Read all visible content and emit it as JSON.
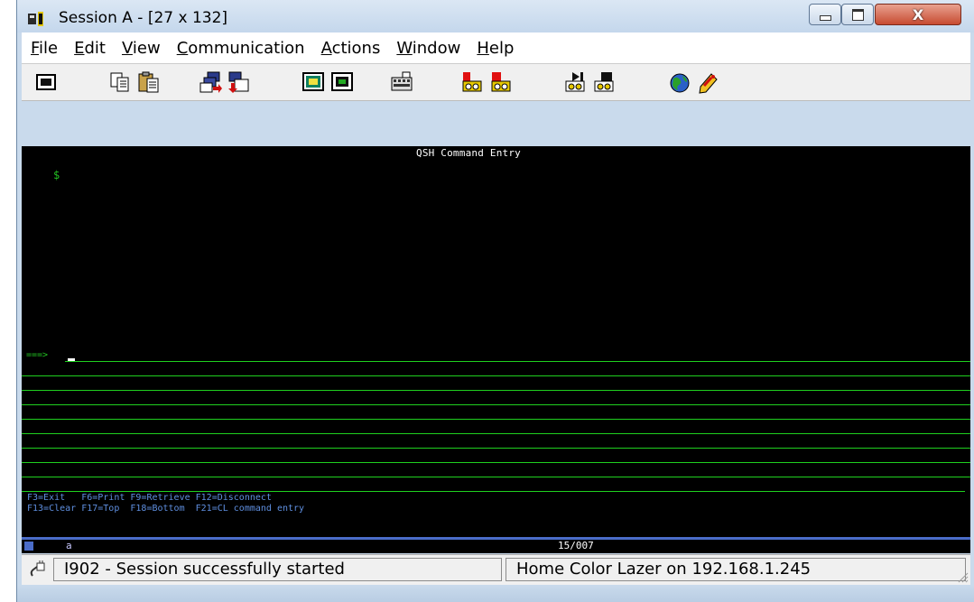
{
  "window": {
    "title": "Session A - [27 x 132]",
    "close_symbol": "X"
  },
  "menu": [
    "File",
    "Edit",
    "View",
    "Communication",
    "Actions",
    "Window",
    "Help"
  ],
  "menu_accelerators": [
    "F",
    "E",
    "V",
    "C",
    "A",
    "W",
    "H"
  ],
  "toolbar": {
    "icons": [
      "print-screen-icon",
      "copy-icon",
      "paste-icon",
      "send-file-icon",
      "receive-file-icon",
      "display-icon",
      "keyboard-map-icon",
      "keypad-icon",
      "record-macro-icon",
      "stop-macro-icon",
      "play-macro-icon",
      "macro-icon",
      "globe-icon",
      "help-icon"
    ]
  },
  "terminal": {
    "title": "QSH Command Entry",
    "prompt": "$",
    "command_arrow": "===>",
    "function_keys_line1": "F3=Exit   F6=Print F9=Retrieve F12=Disconnect",
    "function_keys_line2": "F13=Clear F17=Top  F18=Bottom  F21=CL command entry",
    "oia_session": "a",
    "cursor_position": "15/007"
  },
  "status": {
    "message": "I902 - Session successfully started",
    "printer": "Home Color Lazer on 192.168.1.245"
  },
  "colors": {
    "terminal_bg": "#000000",
    "terminal_green": "#22c022",
    "terminal_blue": "#5f8fe0"
  }
}
